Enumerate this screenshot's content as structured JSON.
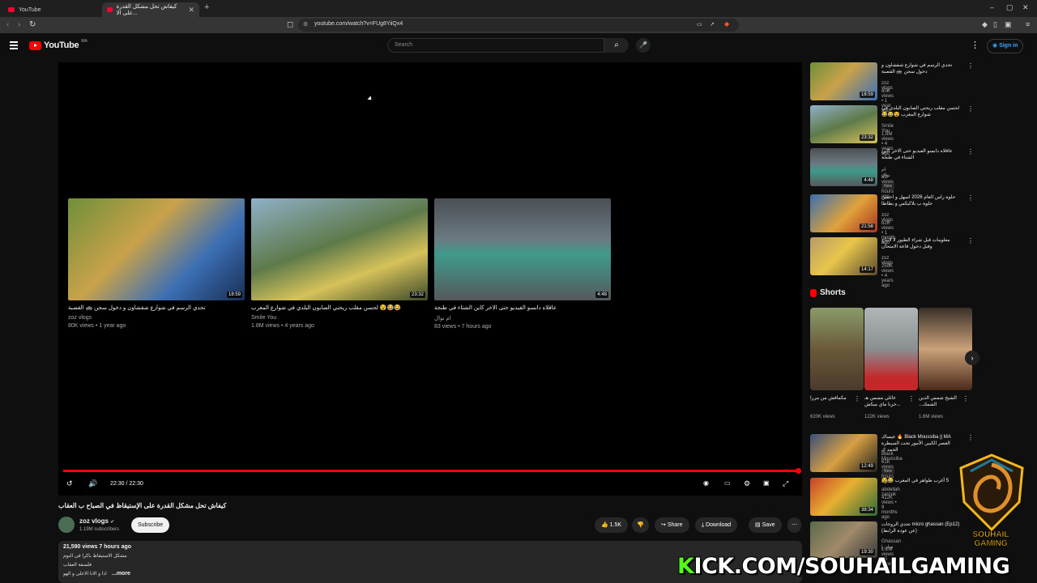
{
  "browser": {
    "tabs": [
      {
        "title": "YouTube",
        "active": false
      },
      {
        "title": "كيفاش تحل مشكل القدرة على الا...",
        "active": true
      }
    ],
    "url": "youtube.com/watch?v=FUg8YiiQx4"
  },
  "header": {
    "logo_text": "YouTube",
    "country_code": "MA",
    "search_placeholder": "Search",
    "signin_label": "Sign in"
  },
  "player": {
    "time": "22:30 / 22:30",
    "progress": 1.0,
    "endscreen": [
      {
        "title": "تحدي الرسم في شوارع شفشاون و دخول سجن 🚓 القصبة",
        "channel": "zoz vlogs",
        "meta": "80K views • 1 year ago",
        "duration": "18:59"
      },
      {
        "title": "😂😂😵 لحسن مقلب ريحني الصابون البلدي في شوارع المغرب",
        "channel": "Smile You",
        "meta": "1.8M views • 4 years ago",
        "duration": "23:32"
      },
      {
        "title": "عاقلاه دابسو الفيديو حتى الاخر كاين الشتاء في طنجة",
        "channel": "ام نوال",
        "meta": "83 views • 7 hours ago",
        "duration": "4:48"
      }
    ]
  },
  "video": {
    "title": "كيفاش تحل مشكل القدرة على الإستيقاظ في الصباح ب العقاب",
    "channel": "zoz vlogs",
    "subscribers": "1.19M subscribers",
    "subscribe_label": "Subscribe",
    "likes": "1.5K",
    "share_label": "Share",
    "download_label": "Download",
    "save_label": "Save"
  },
  "description": {
    "stats": "21,590 views  7 hours ago",
    "lines": [
      "مشكل الاستيقاظ باكرا في النوم",
      "فلسفة العقاب",
      "اذا و الانا الاعلى و الهو"
    ],
    "more_label": "...more"
  },
  "sidebar": {
    "videos": [
      {
        "title": "تحدي الرسم في شوارع شفشاون و دخول سجن 🚓 القصبة",
        "channel": "zoz vlogs",
        "meta": "80K views • 1 year ago",
        "duration": "18:59",
        "badge": ""
      },
      {
        "title": "لحسن مقلب ريحني الصابون البلدي في شوارع المغرب 😵😂😂",
        "channel": "Smile You",
        "meta": "1.8M views • 4 years ago",
        "duration": "23:32",
        "badge": ""
      },
      {
        "title": "عاقلاه دابسو الفيديو حتى الاخر كاين الشتاء في طنجة",
        "channel": "ام نوال",
        "meta": "83 views • 7 hours ago",
        "duration": "4:48",
        "badge": "New"
      },
      {
        "title": "حلوة راس العام 2026 اسهل و احسن حلوة ب بلاكيكس و بطاطا",
        "channel": "zoz vlogs",
        "meta": "82K views • 1 month ago",
        "duration": "21:58",
        "badge": ""
      },
      {
        "title": "معلومات قبل شراء الطيور لا لانتاج وقبل دخول قاعة الامتحان",
        "channel": "zoz vlogs",
        "meta": "250K views • 4 years ago",
        "duration": "14:17",
        "badge": ""
      }
    ],
    "shorts_heading": "Shorts",
    "shorts": [
      {
        "title": "مكماقش من مررا",
        "views": "620K views"
      },
      {
        "title": "عائلي مسمن هـ ...خرنا ماي ميكش",
        "views": "122K views"
      },
      {
        "title": "الشيخ شمس الدين الشمك...",
        "views": "1.6M views"
      }
    ],
    "more_videos": [
      {
        "title": "Black Moussiba || MA 🔥 عيساك العصر الكبير, الأمور تحت السيطرة الحمد ك",
        "channel": "Black Moussiba",
        "meta": "61K views • 12 hours ago",
        "duration": "12:49",
        "badge": "New"
      },
      {
        "title": "5 أغرب طواهر في المغرب 😂😵",
        "channel": "abdellah zarouk",
        "meta": "412K views • 9 months ago",
        "duration": "38:34",
        "badge": ""
      },
      {
        "title": "micro ghassan (Ep12) تحدي الزوجات (عن عودة الرابط)",
        "channel": "Ghassan | صان",
        "meta": "1.2M views • 5 years ago",
        "duration": "19:30",
        "badge": ""
      }
    ]
  },
  "overlay": {
    "kick_k": "K",
    "kick_rest": "ICK.COM/SOUHAILGAMING",
    "brand_line1": "SOUHAIL",
    "brand_line2": "GAMING"
  },
  "colors": {
    "accent": "#ff0000",
    "link": "#3ea6ff",
    "kick_green": "#53fc18",
    "brand_gold": "#f5b81c"
  }
}
